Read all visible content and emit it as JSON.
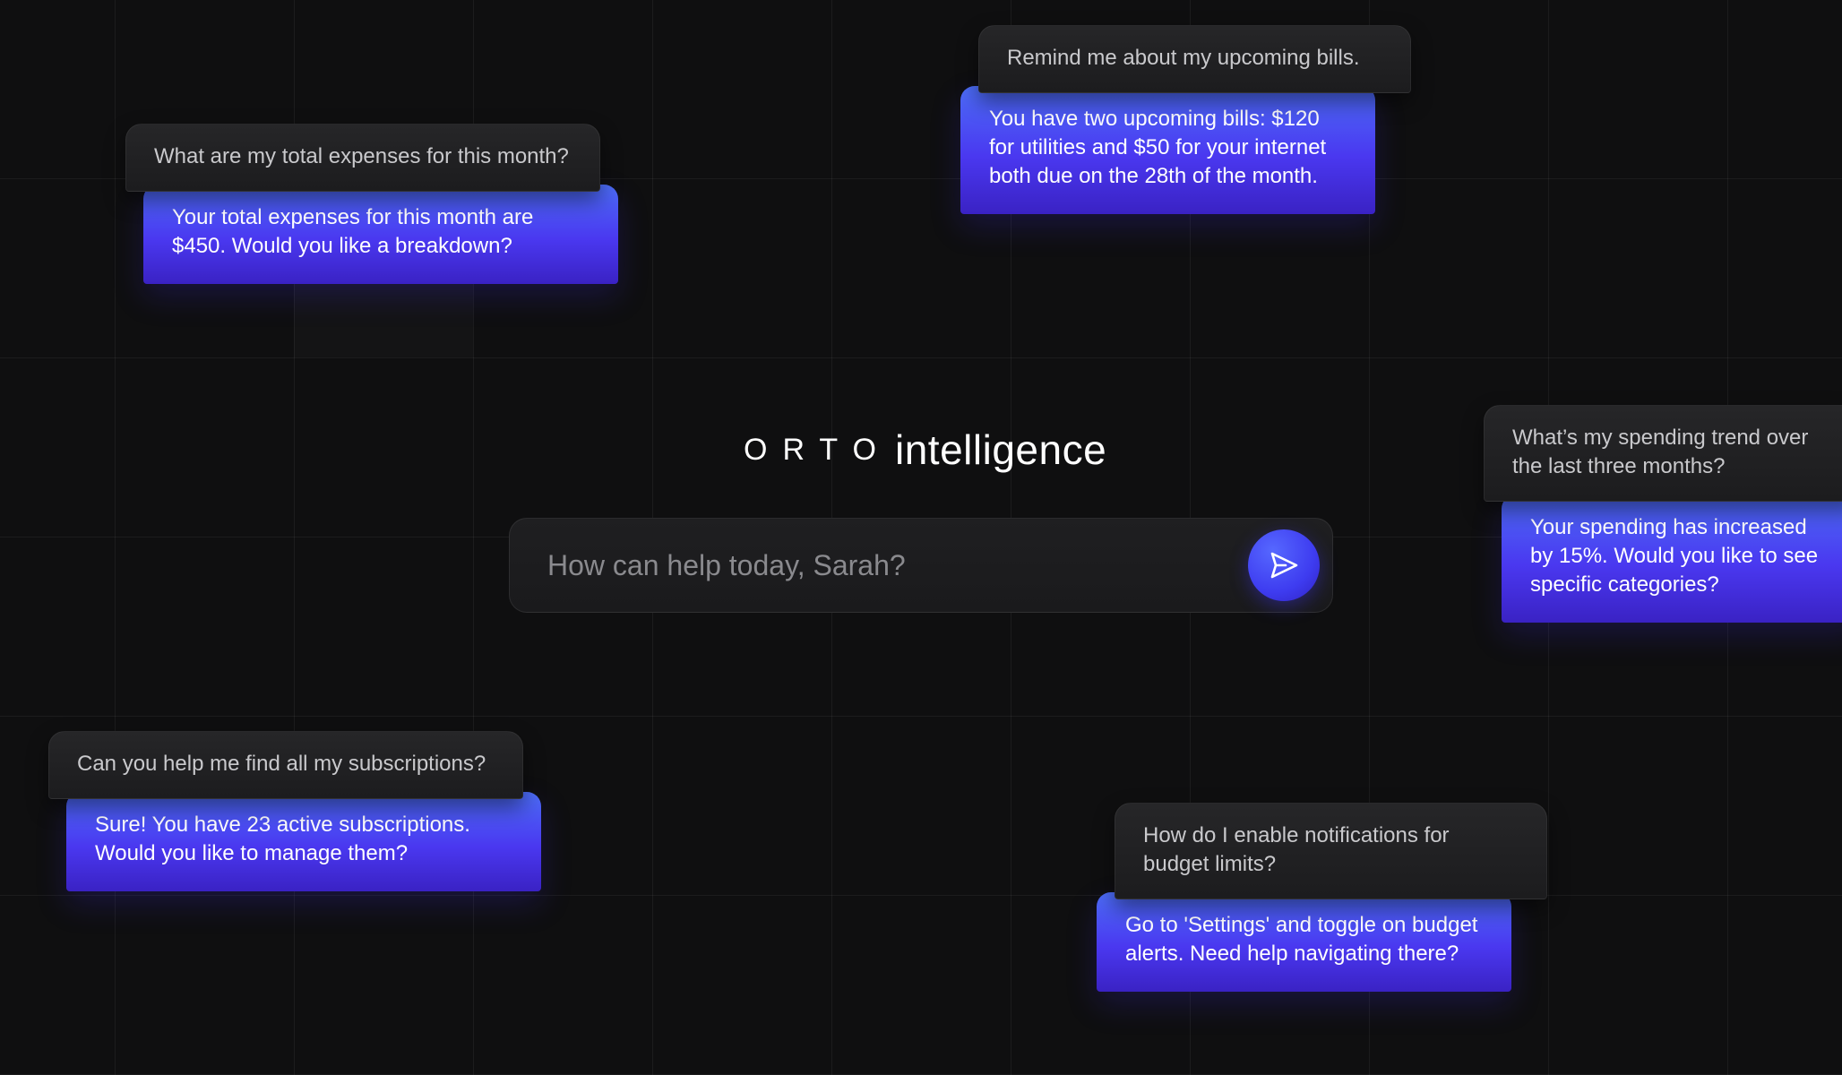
{
  "brand": {
    "logo": "ORTO",
    "name": "intelligence"
  },
  "search": {
    "placeholder": "How can help today, Sarah?",
    "send_icon": "send-icon"
  },
  "chats": [
    {
      "question": "What are my total expenses for this month?",
      "answer": "Your total expenses for this month are $450. Would you like a breakdown?"
    },
    {
      "question": "Remind me about my upcoming bills.",
      "answer": "You have two upcoming bills: $120 for utilities and $50 for your internet both due on the 28th of the month."
    },
    {
      "question": "What’s my spending trend over the last three months?",
      "answer": "Your spending has increased by 15%. Would you like to see specific categories?"
    },
    {
      "question": "Can you help me find all my subscriptions?",
      "answer": "Sure! You have 23 active subscriptions. Would you like to manage them?"
    },
    {
      "question": "How do I enable notifications for budget limits?",
      "answer": "Go to 'Settings' and toggle on budget alerts. Need help navigating there?"
    }
  ],
  "colors": {
    "background": "#0f0f10",
    "accent": "#4a38f0",
    "accent_light": "#4c6df7"
  }
}
